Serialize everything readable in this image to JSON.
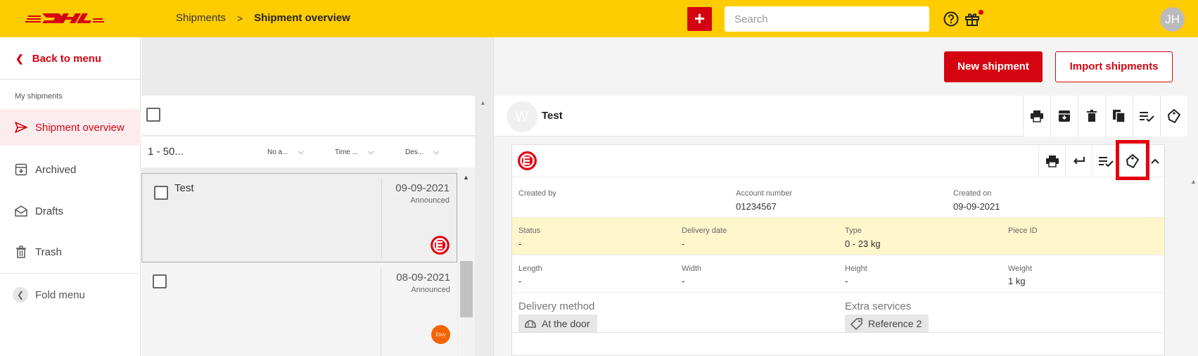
{
  "topbar": {
    "logo_text": "DHL",
    "breadcrumb": {
      "parent": "Shipments",
      "separator": ">",
      "current": "Shipment overview"
    },
    "plus_label": "+",
    "search_placeholder": "Search",
    "avatar_initials": "JH",
    "brand_color": "#ffcc00",
    "accent_color": "#d40511"
  },
  "sidebar": {
    "back_label": "Back to menu",
    "section_label": "My shipments",
    "items": [
      {
        "label": "Shipment overview",
        "icon": "send-icon",
        "active": true
      },
      {
        "label": "Archived",
        "icon": "archive-icon",
        "active": false
      },
      {
        "label": "Drafts",
        "icon": "envelope-icon",
        "active": false
      },
      {
        "label": "Trash",
        "icon": "trash-icon",
        "active": false
      }
    ],
    "fold_label": "Fold menu"
  },
  "list": {
    "range": "1 - 50...",
    "filters": [
      {
        "label": "No a..."
      },
      {
        "label": "Time ..."
      },
      {
        "label": "Des..."
      }
    ],
    "shipments": [
      {
        "title": "Test",
        "date": "09-09-2021",
        "status": "Announced",
        "channel_icon": "ecommerce-logo-icon",
        "selected": true
      },
      {
        "title": "",
        "date": "08-09-2021",
        "status": "Announced",
        "channel_icon": "etsy-logo-icon",
        "channel_text": "Etsy",
        "selected": false
      }
    ]
  },
  "detail": {
    "new_shipment": "New shipment",
    "import_shipments": "Import shipments",
    "avatar_letter": "W",
    "title": "Test",
    "header_tools": [
      "print-icon",
      "archive-icon",
      "trash-icon",
      "copy-icon",
      "checklist-icon",
      "label-tag-icon"
    ],
    "panel_tools": [
      "print-icon",
      "return-icon",
      "checklist-icon",
      "label-tag-icon",
      "chevron-up-icon"
    ],
    "info": {
      "created_by_label": "Created by",
      "created_by_value": "",
      "account_label": "Account number",
      "account_value": "01234567",
      "created_on_label": "Created on",
      "created_on_value": "09-09-2021"
    },
    "status_row": {
      "status_label": "Status",
      "status_value": "-",
      "delivery_label": "Delivery date",
      "delivery_value": "-",
      "type_label": "Type",
      "type_value": "0 - 23 kg",
      "piece_label": "Piece ID",
      "piece_value": ""
    },
    "dims_row": {
      "length_label": "Length",
      "length_value": "-",
      "width_label": "Width",
      "width_value": "-",
      "height_label": "Height",
      "height_value": "-",
      "weight_label": "Weight",
      "weight_value": "1 kg"
    },
    "delivery_method_label": "Delivery method",
    "delivery_method_chip": "At the door",
    "extra_services_label": "Extra services",
    "extra_services_chip": "Reference 2"
  }
}
